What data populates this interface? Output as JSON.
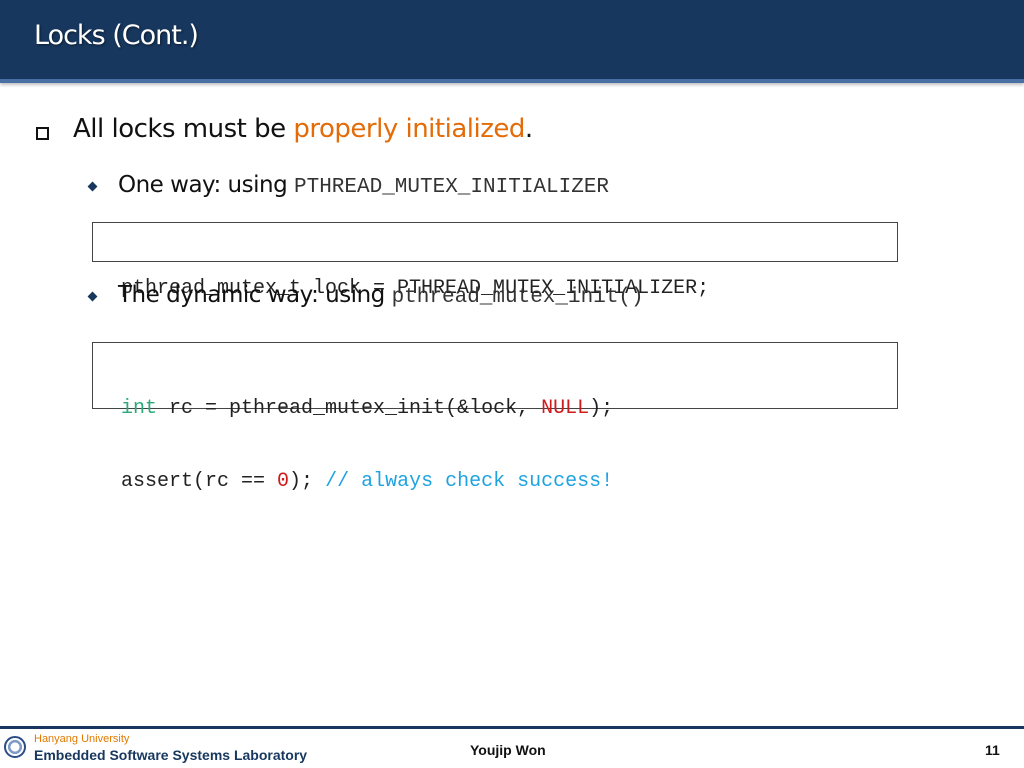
{
  "slide": {
    "title": "Locks (Cont.)"
  },
  "content": {
    "point1": {
      "before": "All locks must be ",
      "highlight": "properly initialized",
      "after": "."
    },
    "sub1": {
      "text": "One way: using ",
      "code": "PTHREAD_MUTEX_INITIALIZER",
      "block": {
        "line1": "pthread_mutex_t lock = PTHREAD_MUTEX_INITIALIZER;"
      }
    },
    "sub2": {
      "text": "The dynamic way: using ",
      "code": "pthread_mutex_init()",
      "block": {
        "line1": {
          "keyword": "int",
          "mid": " rc = pthread_mutex_init(&lock, ",
          "null": "NULL",
          "end": ");"
        },
        "line2": {
          "start": "assert(rc == ",
          "zero": "0",
          "mid": "); ",
          "comment": "// always check success!"
        }
      }
    }
  },
  "footer": {
    "university": "Hanyang University",
    "lab": "Embedded Software Systems Laboratory",
    "author": "Youjip Won",
    "page_number": "11"
  },
  "colors": {
    "title_bar": "#17375e",
    "highlight": "#e36c09",
    "code_keyword": "#2bab7a",
    "code_literal": "#d11a1a",
    "code_comment": "#1fa3e0"
  }
}
